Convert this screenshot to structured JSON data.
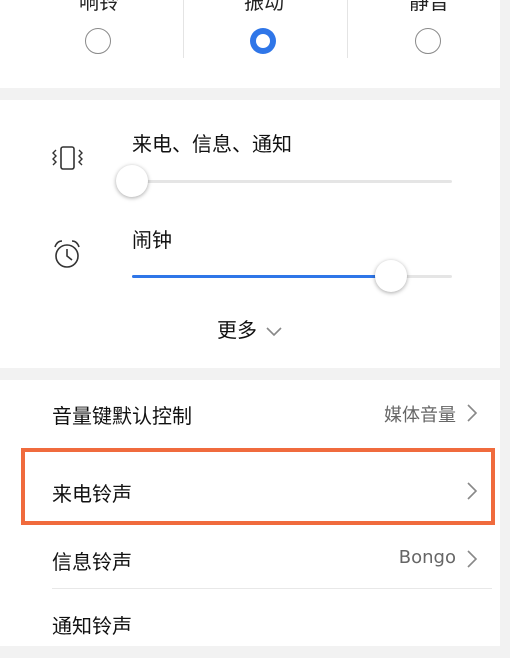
{
  "modes": [
    {
      "label": "响铃",
      "selected": false
    },
    {
      "label": "振动",
      "selected": true
    },
    {
      "label": "静音",
      "selected": false
    }
  ],
  "volume": {
    "sliders": [
      {
        "label": "来电、信息、通知",
        "icon": "vibrate-icon",
        "level": 0.0
      },
      {
        "label": "闹钟",
        "icon": "alarm-clock-icon",
        "level": 0.81
      }
    ],
    "more_label": "更多"
  },
  "settings": {
    "volume_key": {
      "title": "音量键默认控制",
      "value": "媒体音量"
    },
    "ringtone": {
      "title": "来电铃声"
    },
    "message_tone": {
      "title": "信息铃声",
      "value": "Bongo"
    },
    "notification_tone": {
      "title": "通知铃声"
    }
  },
  "colors": {
    "accent": "#2f76e8",
    "highlight": "#f06b3d"
  }
}
